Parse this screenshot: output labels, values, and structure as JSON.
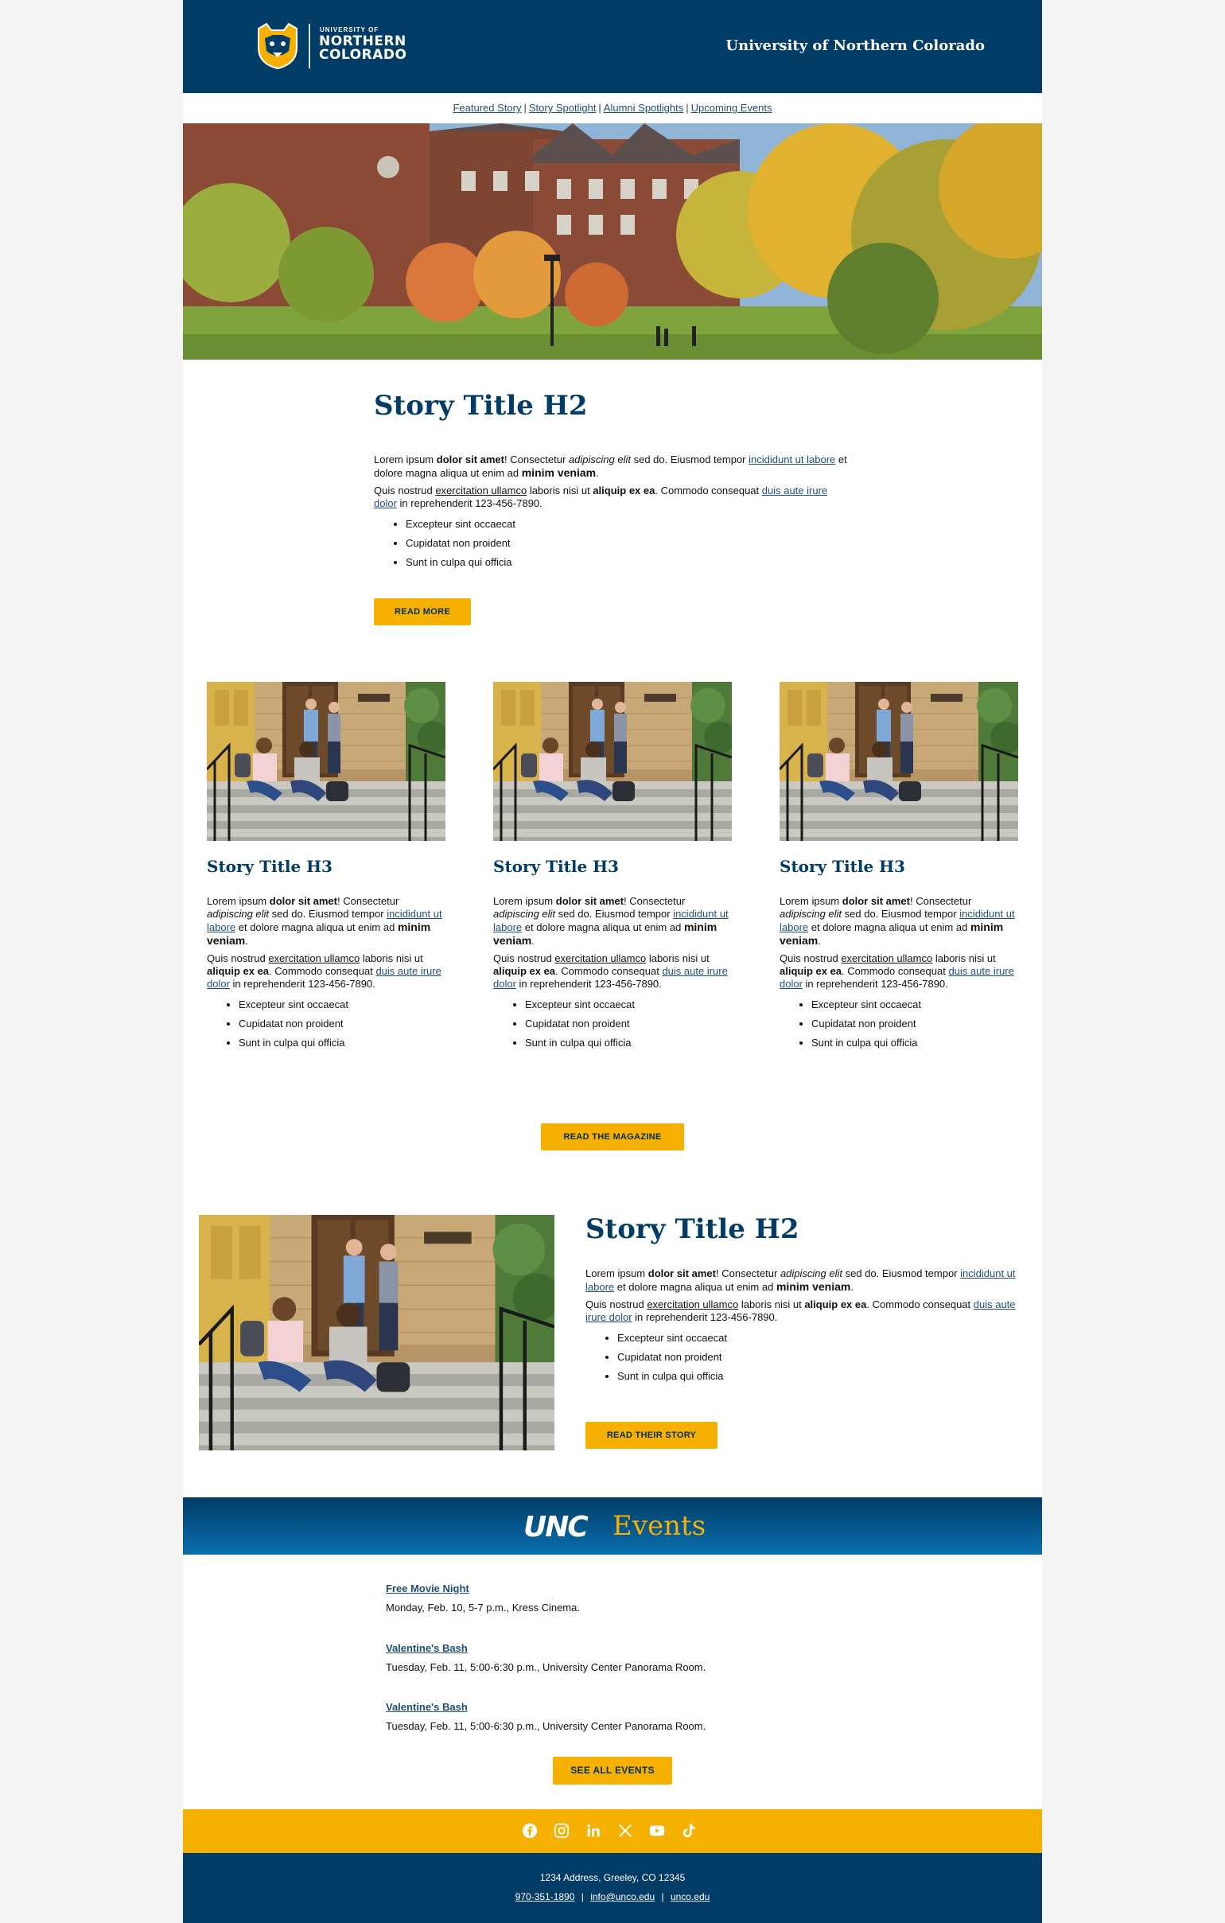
{
  "header": {
    "logo_small": "UNIVERSITY OF",
    "logo_line1": "NORTHERN",
    "logo_line2": "COLORADO",
    "title": "University of Northern Colorado"
  },
  "nav": {
    "items": [
      "Featured Story",
      "Story Spotlight",
      "Alumni Spotlights",
      "Upcoming Events"
    ],
    "separator": "|"
  },
  "story": {
    "title": "Story Title H2",
    "p1": {
      "a": "Lorem ipsum ",
      "b": "dolor sit amet",
      "c": "! Consectetur ",
      "i": "adipiscing elit",
      "d": " sed do. Eiusmod tempor ",
      "link": "incididunt ut labore",
      "e": " et dolore magna aliqua ut enim ad ",
      "big": "minim veniam",
      "f": "."
    },
    "p2": {
      "a": "Quis nostrud ",
      "u": "exercitation ullamco",
      "b": " laboris nisi ut ",
      "bold": "aliquip ex ea",
      "c": ". Commodo consequat ",
      "link": "duis aute irure dolor",
      "d": " in reprehenderit 123-456-7890."
    },
    "bullets": [
      "Excepteur sint occaecat",
      "Cupidatat non proident",
      "Sunt in culpa qui officia"
    ],
    "read_more": "READ MORE"
  },
  "columns": {
    "title": "Story Title H3",
    "read_magazine": "READ THE MAGAZINE"
  },
  "feature": {
    "title": "Story Title H2",
    "button": "READ THEIR STORY"
  },
  "events": {
    "banner_unc": "UNC",
    "banner_word": "Events",
    "items": [
      {
        "title": "Free Movie Night",
        "detail": "Monday, Feb. 10, 5-7 p.m., Kress Cinema."
      },
      {
        "title": "Valentine's Bash",
        "detail": "Tuesday, Feb. 11, 5:00-6:30 p.m., University Center Panorama Room."
      },
      {
        "title": "Valentine's Bash",
        "detail": "Tuesday, Feb. 11, 5:00-6:30 p.m., University Center Panorama Room."
      }
    ],
    "button": "SEE ALL EVENTS"
  },
  "social": [
    "facebook-icon",
    "instagram-icon",
    "linkedin-icon",
    "x-icon",
    "youtube-icon",
    "tiktok-icon"
  ],
  "footer": {
    "address": "1234 Address, Greeley, CO 12345",
    "phone": "970-351-1890",
    "email": "info@unco.edu",
    "site": "unco.edu",
    "sep": "|"
  },
  "colors": {
    "navy": "#013c66",
    "gold": "#f6b000",
    "link": "#1f4e79"
  }
}
